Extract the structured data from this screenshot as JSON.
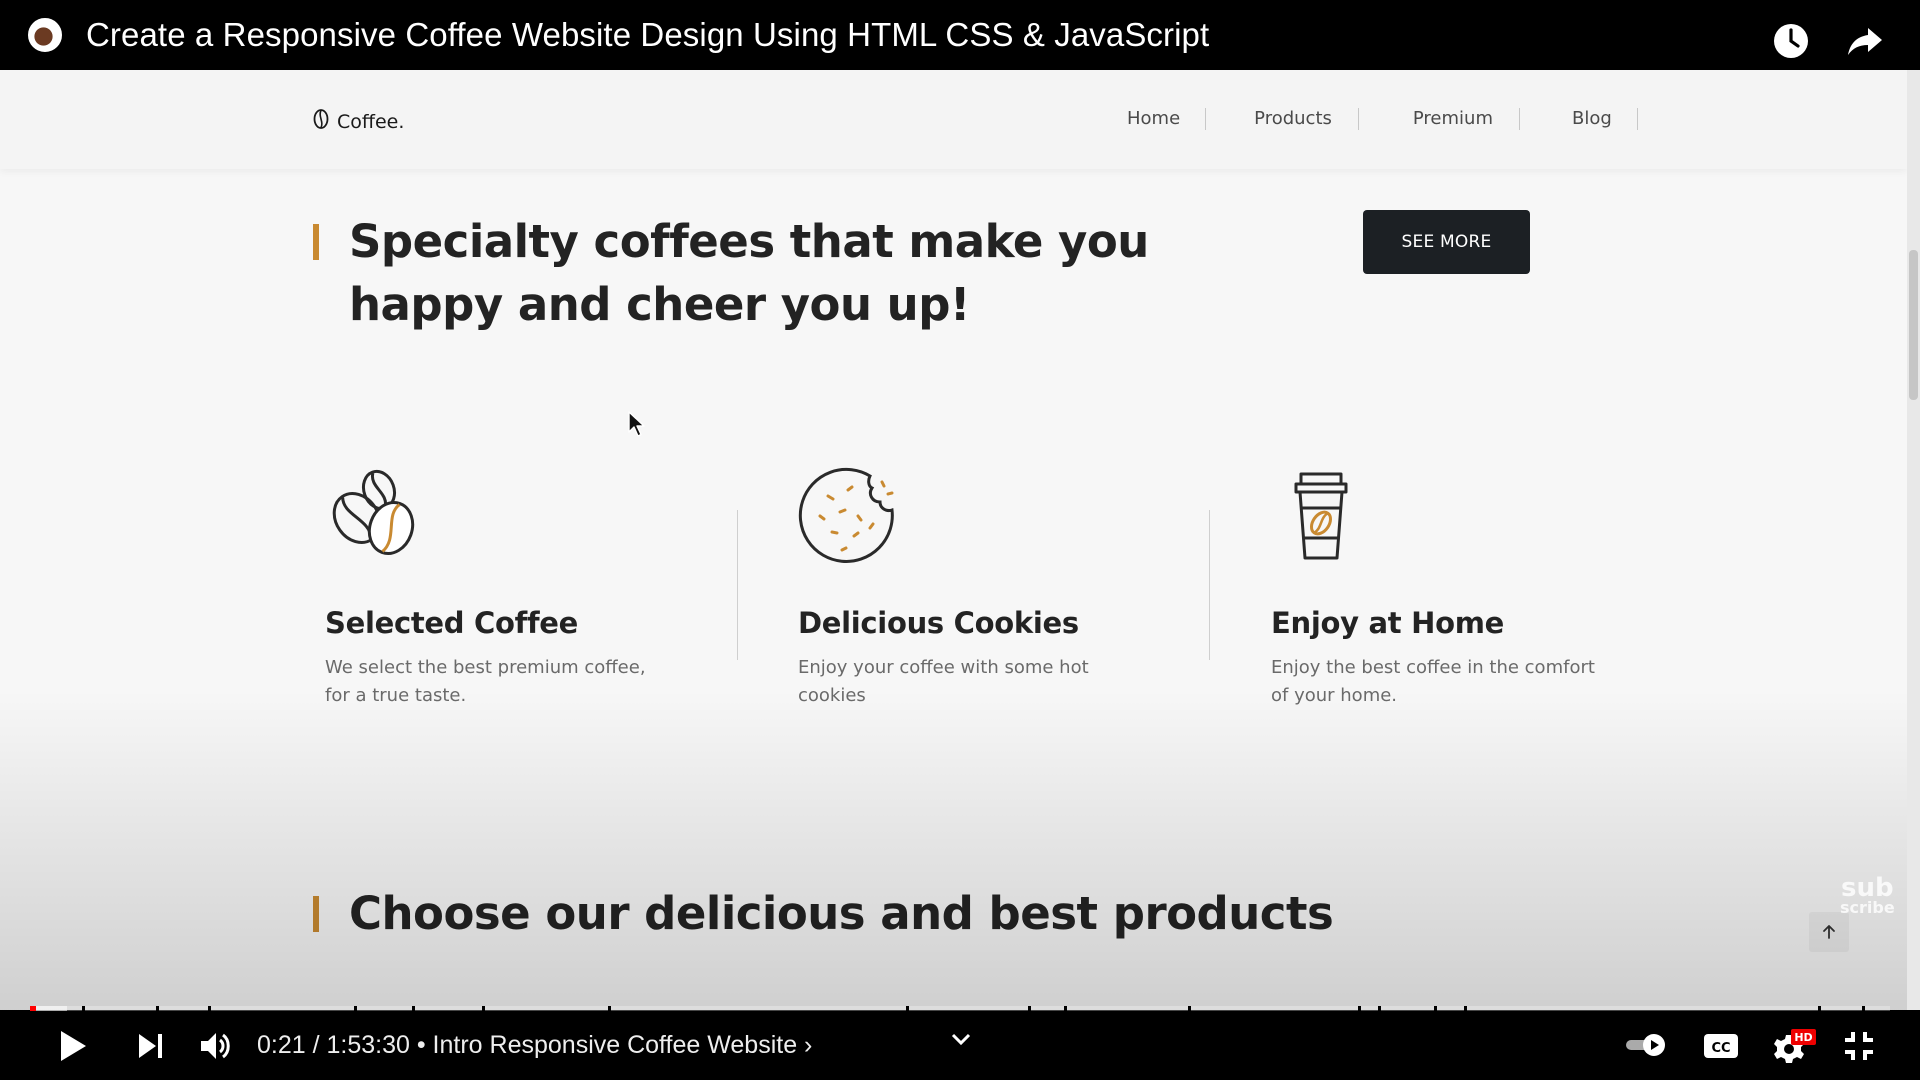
{
  "video": {
    "title": "Create a Responsive Coffee Website Design Using HTML CSS & JavaScript",
    "current_time": "0:21",
    "duration": "1:53:30",
    "chapter": "Intro Responsive Coffee Website",
    "time_display": "0:21 / 1:53:30 • Intro Responsive Coffee Website ›",
    "progress_fraction": 0.0031,
    "buffered_fraction": 0.02,
    "hd_badge": "HD",
    "watermark_line1": "sub",
    "watermark_line2": "scribe"
  },
  "site": {
    "brand": "Coffee.",
    "nav": [
      "Home",
      "Products",
      "Premium",
      "Blog"
    ],
    "hero_title_line1": "Specialty coffees that make you",
    "hero_title_line2": "happy and cheer you up!",
    "see_more": "SEE MORE",
    "features": [
      {
        "icon": "coffee-beans-icon",
        "title": "Selected Coffee",
        "text": "We select the best premium coffee, for a true taste."
      },
      {
        "icon": "cookie-icon",
        "title": "Delicious Cookies",
        "text": "Enjoy your coffee with some hot cookies"
      },
      {
        "icon": "coffee-cup-icon",
        "title": "Enjoy at Home",
        "text": "Enjoy the best coffee in the comfort of your home."
      }
    ],
    "products_title": "Choose our delicious and best products"
  },
  "colors": {
    "accent": "#c98a31",
    "button_dark": "#1c2024",
    "progress_red": "#ff0000"
  }
}
